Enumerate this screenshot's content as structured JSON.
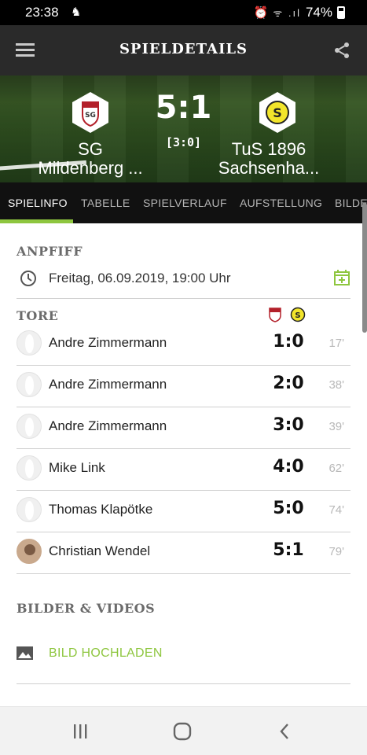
{
  "status_bar": {
    "time": "23:38",
    "battery": "74%"
  },
  "app_bar": {
    "title": "SPIELDETAILS"
  },
  "match": {
    "home_team": "SG Mildenberg ...",
    "away_team": "TuS 1896 Sachsenha...",
    "home_team_line1": "SG",
    "home_team_line2": "Mildenberg ...",
    "away_team_line1": "TuS 1896",
    "away_team_line2": "Sachsenha...",
    "score": "5:1",
    "halftime": "[3:0]"
  },
  "tabs": [
    {
      "label": "SPIELINFO",
      "active": true
    },
    {
      "label": "TABELLE",
      "active": false
    },
    {
      "label": "SPIELVERLAUF",
      "active": false
    },
    {
      "label": "AUFSTELLUNG",
      "active": false
    },
    {
      "label": "BILDE",
      "active": false
    }
  ],
  "kickoff": {
    "section_title": "ANPFIFF",
    "datetime": "Freitag, 06.09.2019, 19:00 Uhr"
  },
  "goals": {
    "section_title": "TORE",
    "items": [
      {
        "player": "Andre Zimmermann",
        "score": "1:0",
        "minute": "17'"
      },
      {
        "player": "Andre Zimmermann",
        "score": "2:0",
        "minute": "38'"
      },
      {
        "player": "Andre Zimmermann",
        "score": "3:0",
        "minute": "39'"
      },
      {
        "player": "Mike Link",
        "score": "4:0",
        "minute": "62'"
      },
      {
        "player": "Thomas Klapötke",
        "score": "5:0",
        "minute": "74'"
      },
      {
        "player": "Christian Wendel",
        "score": "5:1",
        "minute": "79'"
      }
    ]
  },
  "media": {
    "section_title": "BILDER & VIDEOS",
    "upload_label": "BILD HOCHLADEN"
  },
  "colors": {
    "accent": "#8ec63f",
    "appbar": "#2a2a2a",
    "tabs_bg": "#111111"
  }
}
